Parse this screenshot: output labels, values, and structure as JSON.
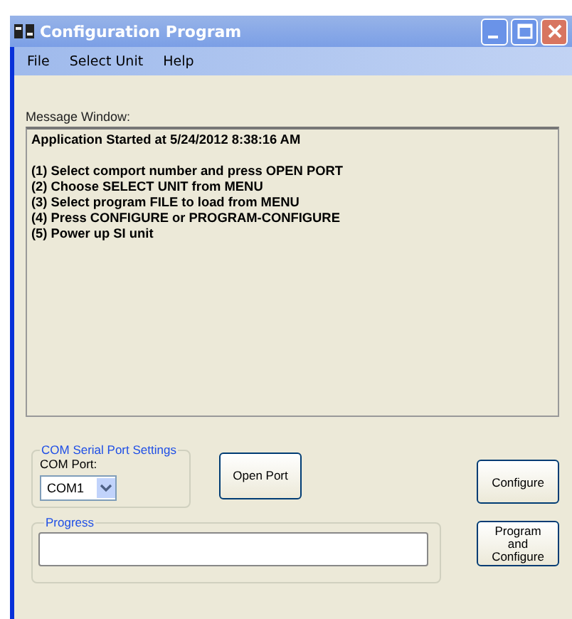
{
  "window": {
    "title": "Configuration Program"
  },
  "menu": [
    "File",
    "Select Unit",
    "Help"
  ],
  "message_window": {
    "label": "Message Window:",
    "header": "Application Started at 5/24/2012 8:38:16 AM",
    "lines": [
      "(1) Select comport number and press OPEN PORT",
      "(2) Choose SELECT UNIT from MENU",
      "(3) Select program FILE to load from MENU",
      "(4) Press CONFIGURE or PROGRAM-CONFIGURE",
      "(5) Power up SI unit"
    ]
  },
  "com_settings": {
    "title": "COM Serial Port Settings",
    "label": "COM Port:",
    "value": "COM1"
  },
  "open_port_button": "Open Port",
  "configure_button": "Configure",
  "progress": {
    "title": "Progress"
  },
  "program_configure_button": [
    "Program",
    "and",
    "Configure"
  ]
}
